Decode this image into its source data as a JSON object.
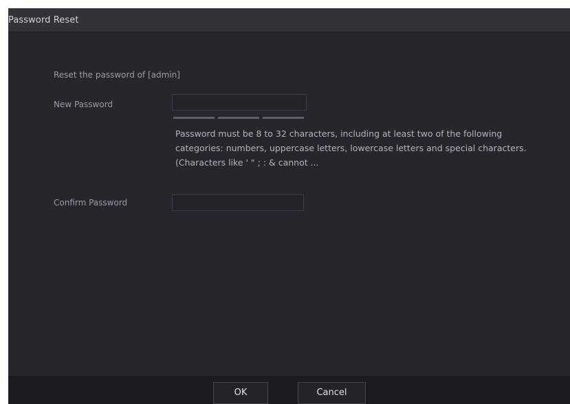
{
  "dialog": {
    "title": "Password Reset"
  },
  "form": {
    "reset_text": "Reset the password of [admin]",
    "new_password_label": "New Password",
    "new_password_value": "",
    "password_hint": "Password must be 8 to 32 characters, including at least two of the following categories: numbers, uppercase letters, lowercase letters and special characters. (Characters like ' \" ; : & cannot ...",
    "confirm_password_label": "Confirm Password",
    "confirm_password_value": ""
  },
  "footer": {
    "ok_label": "OK",
    "cancel_label": "Cancel"
  }
}
